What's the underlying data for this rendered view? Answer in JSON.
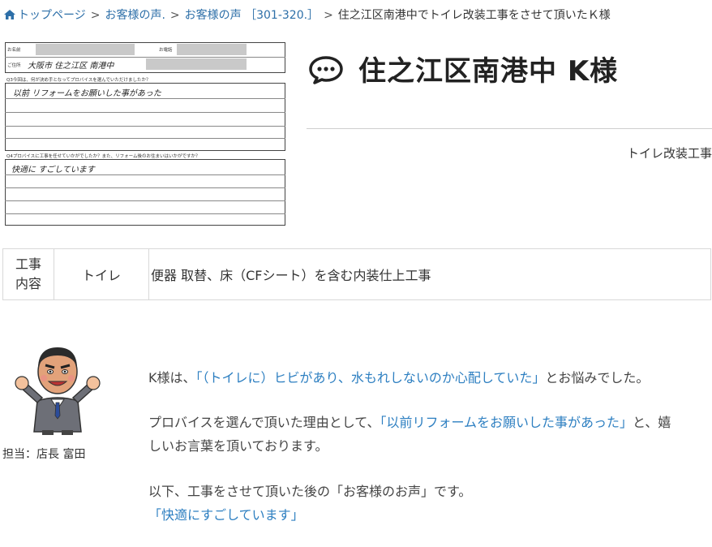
{
  "breadcrumb": {
    "home": "トップページ",
    "voice": "お客様の声.",
    "voice_range": "お客様の声 ［301-320.］",
    "current": "住之江区南港中でトイレ改装工事をさせて頂いたＫ様",
    "separator": ">"
  },
  "form": {
    "label_name": "お名前",
    "label_tel": "お電話",
    "label_address": "ご住所",
    "address_hand": "大阪市 住之江区 南港中",
    "q3": "Q3今回は、何が決め手となってプロバイスを選んでいただけましたか？",
    "q3_answer": "以前 リフォームをお願いした事があった",
    "q4": "Q4プロバイスに工事を任せていかがでしたか？また、リフォーム後のお住まいはいかがですか？",
    "q4_answer": "快適に すごしています"
  },
  "title": "住之江区南港中 K様",
  "category": "トイレ改装工事",
  "work": {
    "header": "工事内容",
    "header_line1": "工事",
    "header_line2": "内容",
    "place": "トイレ",
    "detail": "便器 取替、床（CFシート）を含む内装仕上工事"
  },
  "staff": {
    "name": "担当：店長 富田"
  },
  "story": {
    "p1_pre": "K様は、",
    "p1_quote": "「（トイレに）ヒビがあり、水もれしないのか心配していた」",
    "p1_post": "とお悩みでした。",
    "p2_pre": "プロバイスを選んで頂いた理由として、",
    "p2_quote": "「以前リフォームをお願いした事があった」",
    "p2_post": "と、嬉",
    "p2_line2": "しいお言葉を頂いております。",
    "p3_line1": "以下、工事をさせて頂いた後の「お客様のお声」です。",
    "p3_quote": "「快適にすごしています」"
  },
  "colors": {
    "link": "#2d6fa8",
    "highlight": "#2d7fc1",
    "title": "#222222"
  }
}
